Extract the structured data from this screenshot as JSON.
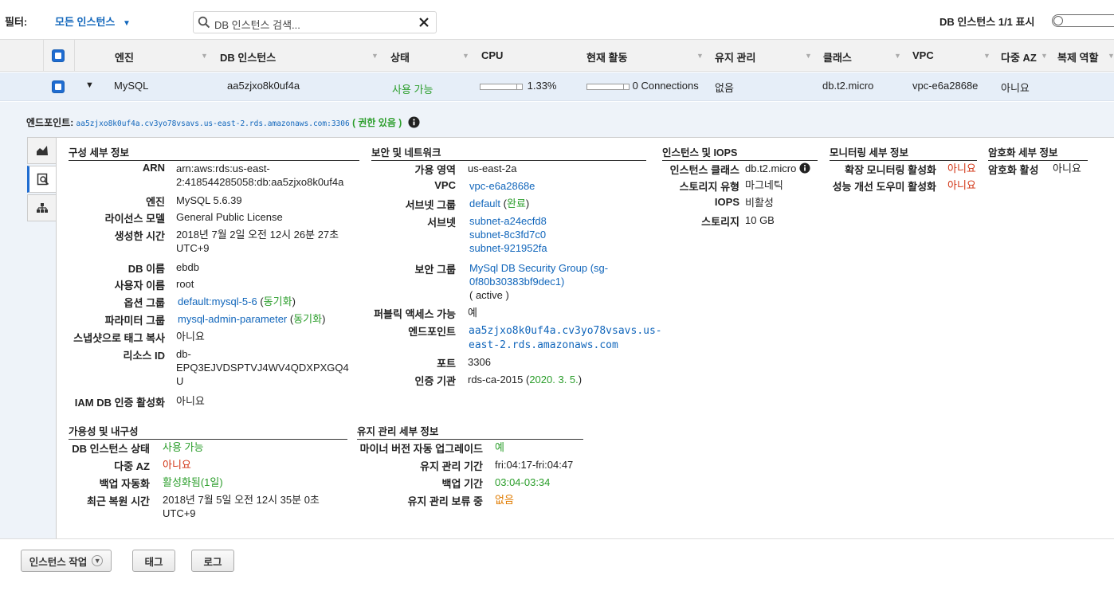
{
  "filter": {
    "label": "필터:",
    "value": "모든 인스턴스",
    "search_placeholder": "DB 인스턴스 검색...",
    "count_text": "DB 인스턴스 1/1 표시"
  },
  "columns": [
    "엔진",
    "DB 인스턴스",
    "상태",
    "CPU",
    "현재 활동",
    "유지 관리",
    "클래스",
    "VPC",
    "다중 AZ",
    "복제 역할"
  ],
  "row": {
    "engine": "MySQL",
    "instance": "aa5zjxo8k0uf4a",
    "status": "사용 가능",
    "cpu": "1.33%",
    "activity": "0 Connections",
    "maintenance": "없음",
    "class": "db.t2.micro",
    "vpc": "vpc-e6a2868e",
    "multi_az": "아니요"
  },
  "endpoint": {
    "label": "엔드포인트:",
    "value": "aa5zjxo8k0uf4a.cv3yo78vsavs.us-east-2.rds.amazonaws.com:3306",
    "auth": "( 권한 있음 )"
  },
  "config": {
    "title": "구성 세부 정보",
    "arn_label": "ARN",
    "arn_line1": "arn:aws:rds:us-east-",
    "arn_line2": "2:418544285058:db:aa5zjxo8k0uf4a",
    "engine_label": "엔진",
    "engine": "MySQL 5.6.39",
    "license_label": "라이선스 모델",
    "license": "General Public License",
    "created_label": "생성한 시간",
    "created_line1": "2018년 7월 2일 오전 12시 26분 27초",
    "created_line2": "UTC+9",
    "dbname_label": "DB 이름",
    "dbname": "ebdb",
    "user_label": "사용자 이름",
    "user": "root",
    "option_label": "옵션 그룹",
    "option": "default:mysql-5-6",
    "option_state": "동기화",
    "param_label": "파라미터 그룹",
    "param": "mysql-admin-parameter",
    "param_state": "동기화",
    "snapshot_label": "스냅샷으로 태그 복사",
    "snapshot": "아니요",
    "resource_label": "리소스 ID",
    "resource_line1": "db-",
    "resource_line2": "EPQ3EJVDSPTVJ4WV4QDXPXGQ4",
    "resource_line3": "U",
    "iam_label": "IAM DB 인증 활성화",
    "iam": "아니요"
  },
  "security": {
    "title": "보안 및 네트워크",
    "az_label": "가용 영역",
    "az": "us-east-2a",
    "vpc_label": "VPC",
    "vpc": "vpc-e6a2868e",
    "subnetgroup_label": "서브넷 그룹",
    "subnetgroup": "default",
    "subnetgroup_state": "완료",
    "subnet_label": "서브넷",
    "subnets": [
      "subnet-a24ecfd8",
      "subnet-8c3fd7c0",
      "subnet-921952fa"
    ],
    "sg_label": "보안 그룹",
    "sg_line1": "MySql DB Security Group (sg-",
    "sg_line2": "0f80b30383bf9dec1)",
    "sg_state": "( active )",
    "public_label": "퍼블릭 액세스 가능",
    "public": "예",
    "endpoint_label": "엔드포인트",
    "endpoint_line1": "aa5zjxo8k0uf4a.cv3yo78vsavs.us-",
    "endpoint_line2": "east-2.rds.amazonaws.com",
    "port_label": "포트",
    "port": "3306",
    "ca_label": "인증 기관",
    "ca": "rds-ca-2015",
    "ca_date": "2020. 3. 5."
  },
  "instance_iops": {
    "title": "인스턴스 및 IOPS",
    "class_label": "인스턴스 클래스",
    "class": "db.t2.micro",
    "storage_type_label": "스토리지 유형",
    "storage_type": "마그네틱",
    "iops_label": "IOPS",
    "iops": "비활성",
    "storage_label": "스토리지",
    "storage": "10 GB"
  },
  "monitoring": {
    "title": "모니터링 세부 정보",
    "enhanced_label": "확장 모니터링 활성화",
    "enhanced": "아니요",
    "insights_label": "성능 개선 도우미 활성화",
    "insights": "아니요"
  },
  "encryption": {
    "title": "암호화 세부 정보",
    "enabled_label": "암호화 활성",
    "enabled": "아니요"
  },
  "availability": {
    "title": "가용성 및 내구성",
    "state_label": "DB 인스턴스 상태",
    "state": "사용 가능",
    "multiaz_label": "다중 AZ",
    "multiaz": "아니요",
    "backup_label": "백업 자동화",
    "backup": "활성화됨(1일)",
    "restore_label": "최근 복원 시간",
    "restore_line1": "2018년 7월 5일 오전 12시 35분 0초",
    "restore_line2": "UTC+9"
  },
  "maintenance": {
    "title": "유지 관리 세부 정보",
    "autominor_label": "마이너 버전 자동 업그레이드",
    "autominor": "예",
    "window_label": "유지 관리 기간",
    "window": "fri:04:17-fri:04:47",
    "backup_window_label": "백업 기간",
    "backup_window": "03:04-03:34",
    "pending_label": "유지 관리 보류 중",
    "pending": "없음"
  },
  "footer": {
    "instance_actions": "인스턴스 작업",
    "tags": "태그",
    "logs": "로그"
  },
  "colors": {
    "link": "#1166bb",
    "green": "#2a9d2a",
    "red": "#d13212",
    "accent": "#1f6cd1"
  }
}
